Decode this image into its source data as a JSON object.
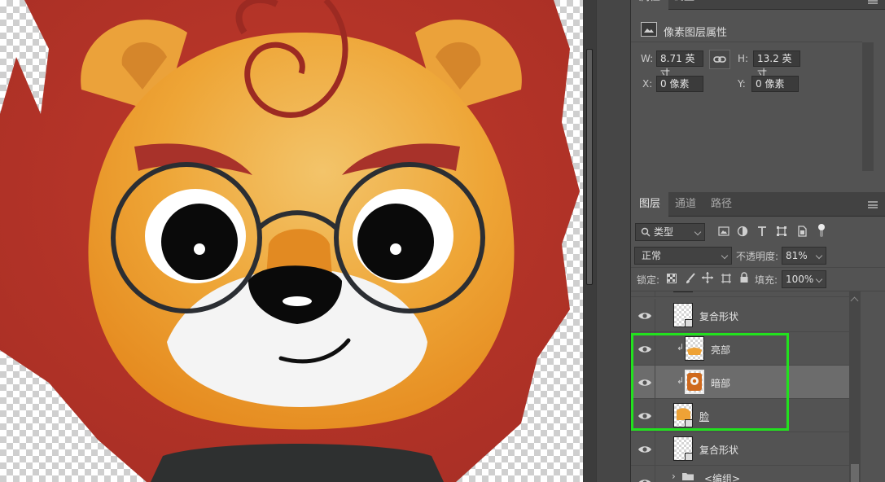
{
  "properties_panel": {
    "tabs": [
      "属性",
      "调整"
    ],
    "header_title": "像素图层属性",
    "w_label": "W:",
    "w_value": "8.71 英寸",
    "h_label": "H:",
    "h_value": "13.2 英寸",
    "x_label": "X:",
    "x_value": "0 像素",
    "y_label": "Y:",
    "y_value": "0 像素"
  },
  "layers_panel": {
    "tabs": [
      "图层",
      "通道",
      "路径"
    ],
    "filter_kind": "类型",
    "blend_mode": "正常",
    "opacity_label": "不透明度:",
    "opacity_value": "81%",
    "lock_label": "锁定:",
    "fill_label": "填充:",
    "fill_value": "100%",
    "layers": [
      {
        "name": "复合形状",
        "clipped": false,
        "selected": false,
        "thumb": "shape"
      },
      {
        "name": "亮部",
        "clipped": true,
        "selected": false,
        "thumb": "light"
      },
      {
        "name": "暗部",
        "clipped": true,
        "selected": true,
        "thumb": "dark"
      },
      {
        "name": "脸",
        "clipped": false,
        "selected": false,
        "thumb": "face"
      },
      {
        "name": "复合形状",
        "clipped": false,
        "selected": false,
        "thumb": "shape"
      },
      {
        "name": "<编组>",
        "clipped": false,
        "selected": false,
        "thumb": "group"
      }
    ]
  },
  "colors": {
    "highlight_box": "#22e11e",
    "mane": "#b5342a",
    "face": "#eea236",
    "panel_bg": "#535353"
  }
}
